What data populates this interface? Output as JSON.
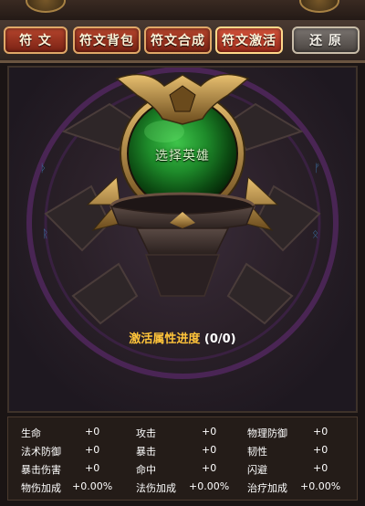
{
  "tabs": [
    {
      "label": "符 文"
    },
    {
      "label": "符文背包"
    },
    {
      "label": "符文合成"
    },
    {
      "label": "符文激活"
    }
  ],
  "reset_label": "还 原",
  "hero_select_label": "选择英雄",
  "progress": {
    "label": "激活属性进度",
    "value": "(0/0)"
  },
  "stats": [
    {
      "name": "生命",
      "value": "+0"
    },
    {
      "name": "攻击",
      "value": "+0"
    },
    {
      "name": "物理防御",
      "value": "+0"
    },
    {
      "name": "法术防御",
      "value": "+0"
    },
    {
      "name": "暴击",
      "value": "+0"
    },
    {
      "name": "韧性",
      "value": "+0"
    },
    {
      "name": "暴击伤害",
      "value": "+0"
    },
    {
      "name": "命中",
      "value": "+0"
    },
    {
      "name": "闪避",
      "value": "+0"
    },
    {
      "name": "物伤加成",
      "value": "+0.00%"
    },
    {
      "name": "法伤加成",
      "value": "+0.00%"
    },
    {
      "name": "治疗加成",
      "value": "+0.00%"
    }
  ],
  "colors": {
    "accent": "#ffc43a",
    "tab_red": "#b4442c",
    "orb_green": "#1e8a2a"
  }
}
